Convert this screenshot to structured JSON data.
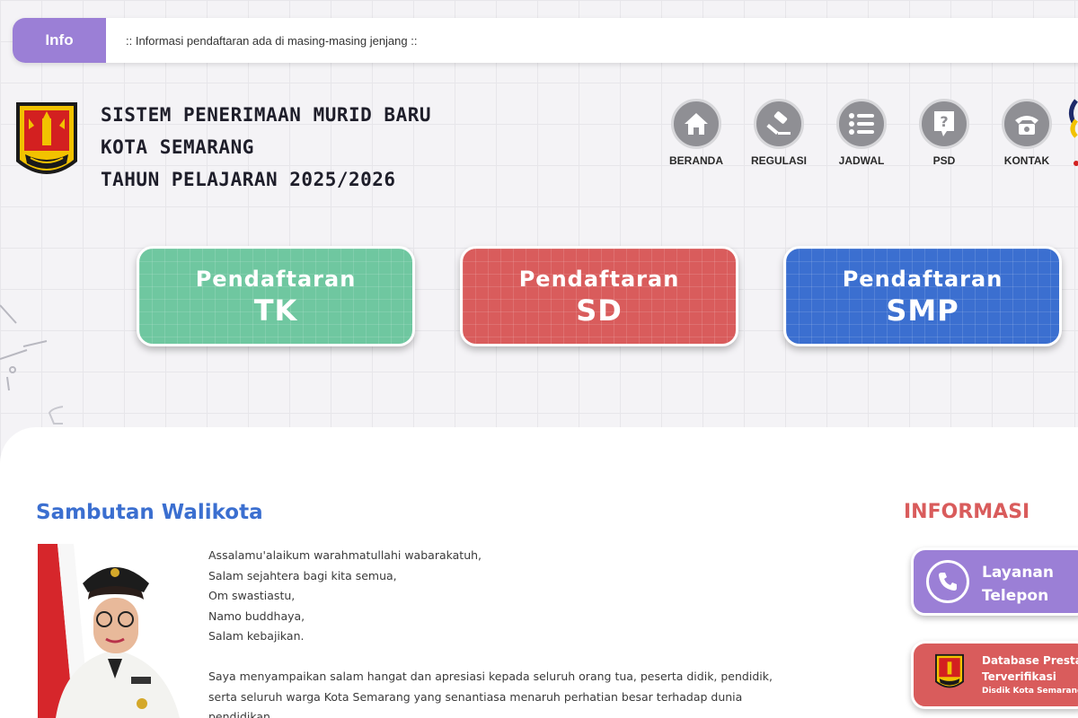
{
  "info_bar": {
    "label": "Info",
    "message": ":: Informasi pendaftaran ada di masing-masing jenjang ::"
  },
  "header": {
    "title_lines": [
      "SISTEM PENERIMAAN MURID BARU",
      "KOTA SEMARANG",
      "TAHUN PELAJARAN 2025/2026"
    ]
  },
  "nav": {
    "items": [
      {
        "label": "BERANDA",
        "icon": "home-icon"
      },
      {
        "label": "REGULASI",
        "icon": "gavel-icon"
      },
      {
        "label": "JADWAL",
        "icon": "list-icon"
      },
      {
        "label": "PSD",
        "icon": "question-icon"
      },
      {
        "label": "KONTAK",
        "icon": "phone-icon"
      }
    ]
  },
  "registration": [
    {
      "line1": "Pendaftaran",
      "line2": "TK",
      "color": "#6fc7a0"
    },
    {
      "line1": "Pendaftaran",
      "line2": "SD",
      "color": "#d95c5c"
    },
    {
      "line1": "Pendaftaran",
      "line2": "SMP",
      "color": "#3b6fd0"
    }
  ],
  "sambutan": {
    "title": "Sambutan Walikota",
    "greetings": [
      "Assalamu'alaikum warahmatullahi wabarakatuh,",
      "Salam sejahtera bagi kita semua,",
      "Om swastiastu,",
      "Namo buddhaya,",
      "Salam kebajikan."
    ],
    "paragraph": "Saya menyampaikan salam hangat dan apresiasi kepada seluruh orang tua, peserta didik, pendidik, serta seluruh warga Kota Semarang yang senantiasa menaruh perhatian besar terhadap dunia pendidikan."
  },
  "informasi": {
    "title": "INFORMASI",
    "call": {
      "line1": "Layanan",
      "line2": "Telepon"
    },
    "database": {
      "line1": "Database Presta",
      "line2": "Terverifikasi",
      "line3": "Disdik Kota Semarang"
    }
  },
  "colors": {
    "purple": "#9b7fd6",
    "green": "#6fc7a0",
    "red": "#d95c5c",
    "blue": "#3b6fd0",
    "nav_gray": "#8f8f94"
  }
}
